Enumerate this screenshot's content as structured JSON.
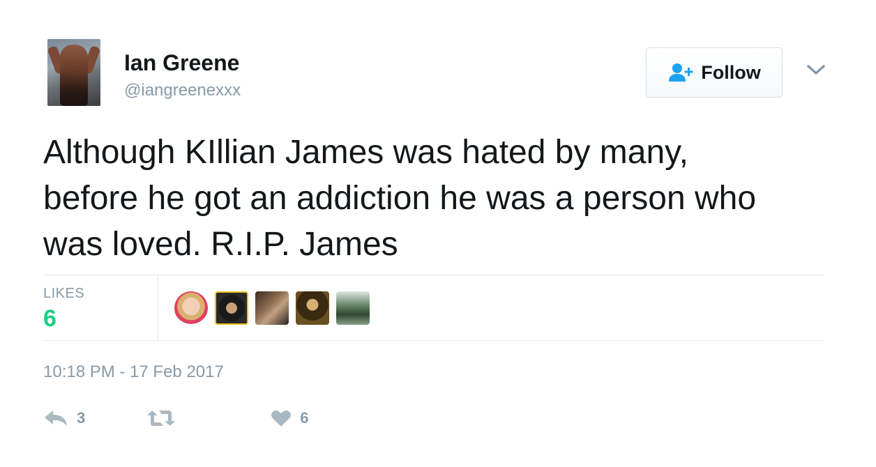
{
  "user": {
    "name": "Ian Greene",
    "handle": "@iangreenexxx"
  },
  "follow_button": {
    "label": "Follow",
    "icon": "follow-user-plus-icon"
  },
  "menu": {
    "icon": "chevron-down-icon"
  },
  "tweet": {
    "text": "Although KIllian James was hated by many,\nbefore he got an addiction he was a person who\nwas loved. R.I.P.  James"
  },
  "stats": {
    "likes_label": "LIKES",
    "likes_count": "6"
  },
  "timestamp": "10:18 PM - 17 Feb 2017",
  "actions": {
    "reply_count": "3",
    "retweet_count": "",
    "like_count": "6"
  },
  "colors": {
    "accent": "#1da1f2",
    "likes": "#19cf86",
    "muted": "#8899a6",
    "icon": "#aab8c2"
  }
}
